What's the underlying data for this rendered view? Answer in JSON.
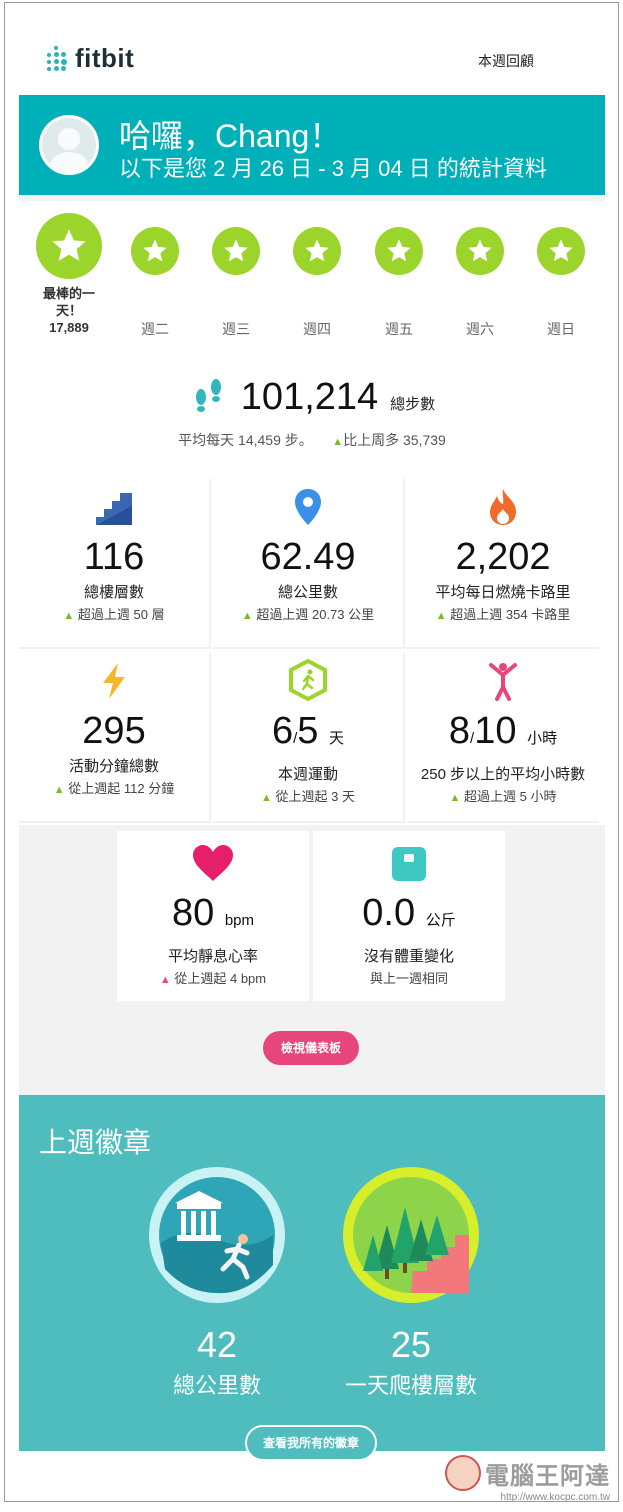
{
  "header": {
    "brand": "fitbit",
    "week_link": "本週回顧"
  },
  "banner": {
    "greeting": "哈囉，Chang！",
    "subtitle": "以下是您 2 月 26 日 - 3 月 04 日 的統計資料"
  },
  "stars": {
    "best_day_label_line1": "最棒的一",
    "best_day_label_line2": "天！",
    "best_day_steps": "17,889",
    "days": [
      "週二",
      "週三",
      "週四",
      "週五",
      "週六",
      "週日"
    ]
  },
  "steps": {
    "total": "101,214",
    "unit": "總步數",
    "avg": "平均每天 14,459 步。",
    "compare": "比上周多 35,739"
  },
  "stats": [
    {
      "icon": "stairs-icon",
      "value": "116",
      "title": "總樓層數",
      "delta": "超過上週 50 層",
      "up": true
    },
    {
      "icon": "map-pin-icon",
      "value": "62.49",
      "title": "總公里數",
      "delta": "超過上週 20.73 公里",
      "up": true
    },
    {
      "icon": "flame-icon",
      "value": "2,202",
      "title": "平均每日燃燒卡路里",
      "delta": "超過上週 354 卡路里",
      "up": true
    },
    {
      "icon": "lightning-icon",
      "value": "295",
      "title": "活動分鐘總數",
      "delta": "從上週起 112 分鐘",
      "up": true
    },
    {
      "icon": "exercise-icon",
      "value_a": "6",
      "value_b": "5",
      "unit": "天",
      "title": "本週運動",
      "delta": "從上週起 3 天",
      "up": true
    },
    {
      "icon": "person-icon",
      "value_a": "8",
      "value_b": "10",
      "unit": "小時",
      "title": "250 步以上的平均小時數",
      "delta": "超過上週 5 小時",
      "up": true
    }
  ],
  "health": [
    {
      "icon": "heart-icon",
      "value": "80",
      "unit": "bpm",
      "title": "平均靜息心率",
      "delta": "從上週起 4 bpm",
      "up": false
    },
    {
      "icon": "scale-icon",
      "value": "0.0",
      "unit": "公斤",
      "title": "沒有體重變化",
      "delta": "與上一週相同"
    }
  ],
  "dashboard_button": "檢視儀表板",
  "badges": {
    "title": "上週徽章",
    "items": [
      {
        "value": "42",
        "label": "總公里數"
      },
      {
        "value": "25",
        "label": "一天爬樓層數"
      }
    ],
    "button": "查看我所有的徽章"
  },
  "watermark": {
    "text": "電腦王阿達",
    "url": "http://www.kocpc.com.tw"
  },
  "colors": {
    "teal": "#00b0b9",
    "green": "#9bd52c",
    "pink": "#e6467a",
    "badge_bg": "#4fbdbd"
  }
}
